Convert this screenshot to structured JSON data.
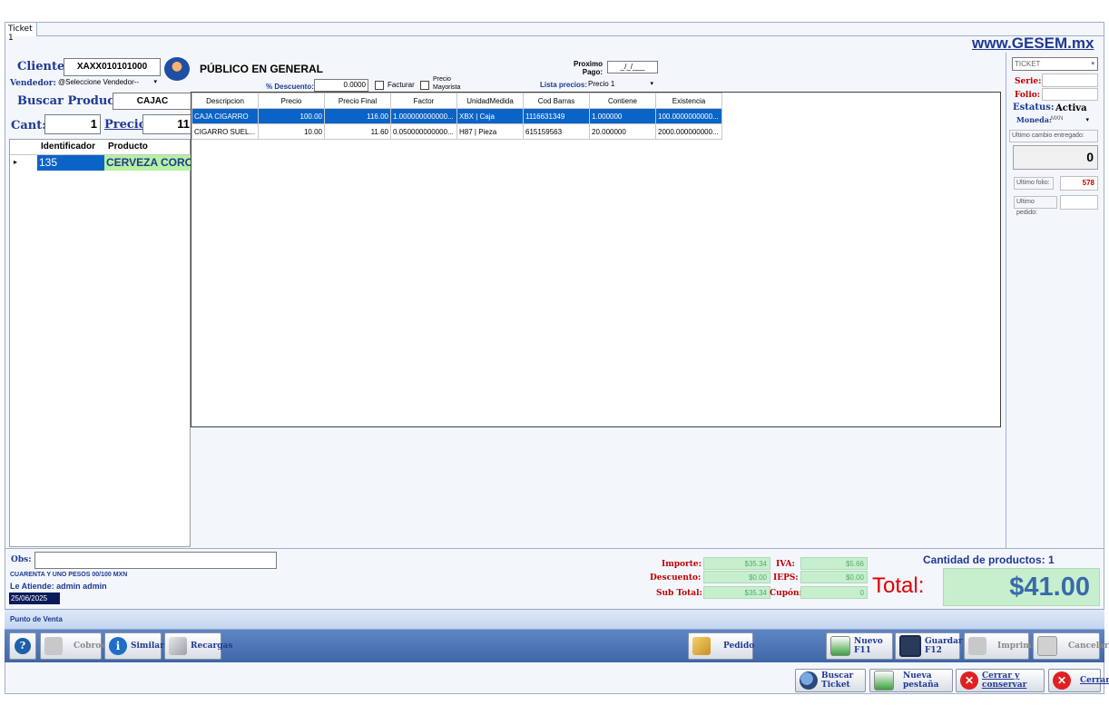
{
  "tab": {
    "label": "Ticket 1"
  },
  "site": "www.GESEM.mx",
  "cliente": {
    "label": "Cliente:",
    "rfc": "XAXX010101000",
    "name": "PÚBLICO EN GENERAL"
  },
  "vendedor": {
    "label": "Vendedor:",
    "value": "@Seleccione Vendedor--"
  },
  "buscar": {
    "label": "Buscar Producto:",
    "value": "CAJAC"
  },
  "cant": {
    "label": "Cant:",
    "value": "1"
  },
  "precio": {
    "label": "Precio",
    "value": "11"
  },
  "descuento": {
    "label": "% Descuento:",
    "value": "0.0000"
  },
  "facturar": {
    "label": "Facturar"
  },
  "mayorista": {
    "label": "Precio Mayorista"
  },
  "proximo": {
    "label": "Proximo Pago:",
    "value": "_/_/___"
  },
  "lista": {
    "label": "Lista precios:",
    "value": "Precio 1"
  },
  "ticket_grid": {
    "headers": [
      "Identificador",
      "Producto"
    ],
    "rows": [
      {
        "id": "135",
        "producto": "CERVEZA CORONA"
      }
    ]
  },
  "search_grid": {
    "headers": [
      "Descripcion",
      "Precio",
      "Precio Final",
      "Factor",
      "UnidadMedida",
      "Cod Barras",
      "Contiene",
      "Existencia"
    ],
    "rows": [
      [
        "CAJA CIGARRO",
        "100.00",
        "116.00",
        "1.000000000000...",
        "XBX | Caja",
        "1116631349",
        "1.000000",
        "100.0000000000..."
      ],
      [
        "CIGARRO SUEL...",
        "10.00",
        "11.60",
        "0.050000000000...",
        "H87 | Pieza",
        "615159563",
        "20.000000",
        "2000.000000000..."
      ]
    ]
  },
  "right_panel": {
    "doc_type": "TICKET",
    "serie_label": "Serie:",
    "folio_label": "Folio:",
    "estatus_label": "Estatus:",
    "estatus_value": "Activa",
    "moneda_label": "Moneda:",
    "moneda_value": "MXN",
    "ultimo_cambio": "Ultimo cambio entregado:",
    "cambio_value": "0",
    "ultimo_folio_label": "Ultimo folio:",
    "ultimo_folio_value": "578",
    "ultimo_pedido_label": "Ultimo pedido:"
  },
  "footer": {
    "obs_label": "Obs:",
    "letras": "CUARENTA Y UNO PESOS  00/100 MXN",
    "atiende": "Le Atiende: admin admin",
    "fecha": "25/06/2025",
    "importe_label": "Importe:",
    "importe": "$35.34",
    "descuento_label": "Descuento:",
    "descuento": "$0.00",
    "subtotal_label": "Sub Total:",
    "subtotal": "$35.34",
    "iva_label": "IVA:",
    "iva": "$5.66",
    "ieps_label": "IEPS:",
    "ieps": "$0.00",
    "cupon_label": "Cupón:",
    "cupon": "0",
    "cantidad": "Cantidad de productos: 1",
    "total_label": "Total:",
    "total": "$41.00"
  },
  "pos_bar": {
    "label": "Punto de Venta"
  },
  "toolbar": {
    "cobros": "Cobros",
    "similares": "Similares",
    "recargas": "Recargas",
    "pedido": "Pedido",
    "nuevo": "Nuevo F11",
    "guardar": "Guardar F12",
    "imprimir": "Imprimir",
    "cancelar": "Cancelar"
  },
  "bottom": {
    "buscar_ticket": "Buscar Ticket",
    "nueva_pestana": "Nueva pestaña",
    "cerrar_conservar": "Cerrar y conservar",
    "cerrar": "Cerrar"
  }
}
